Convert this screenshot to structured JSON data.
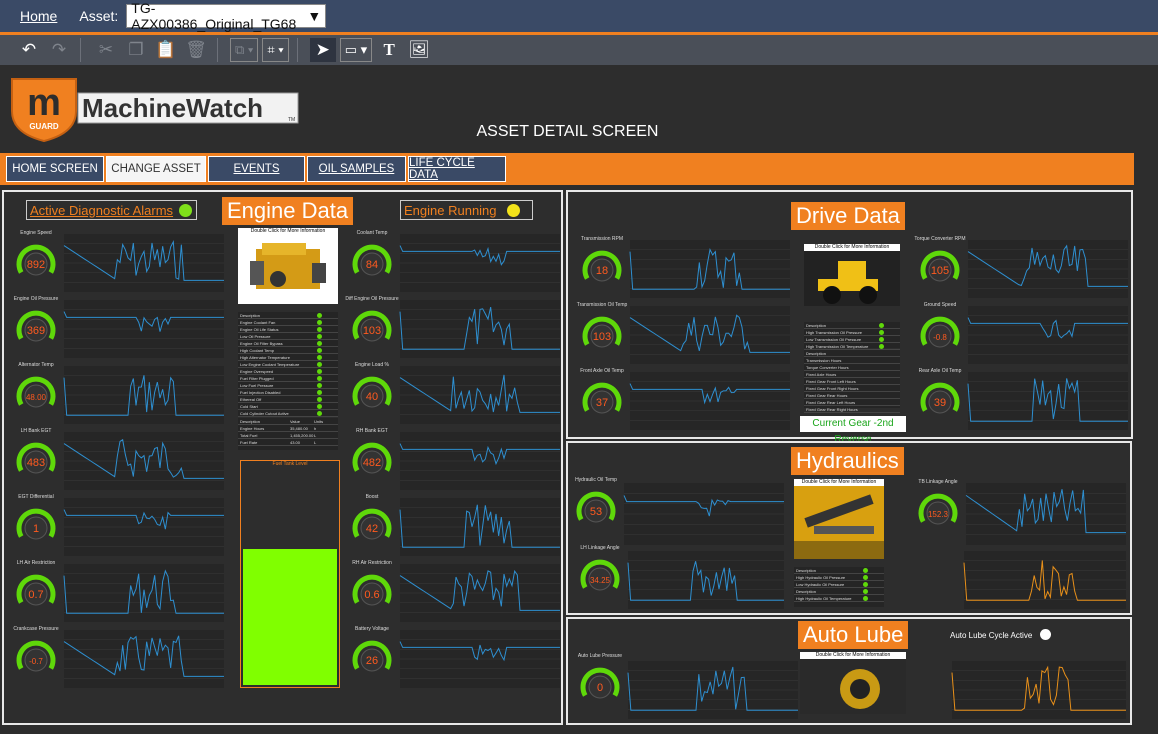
{
  "topbar": {
    "home_link": "Home",
    "asset_label": "Asset:",
    "asset_value": "TG-AZX00386_Original_TG68"
  },
  "toolbar": {
    "icons": [
      "undo-icon",
      "redo-icon",
      "cut-icon",
      "copy-icon",
      "paste-icon",
      "delete-icon",
      "group-icon",
      "grid-icon",
      "pointer-icon",
      "rectangle-icon",
      "text-icon",
      "image-icon"
    ]
  },
  "brand": {
    "logo_text": "MachineWatch",
    "shield_letter": "m",
    "shield_sub": "GUARD",
    "tm": "TM"
  },
  "page_title": "ASSET DETAIL SCREEN",
  "nav": [
    {
      "label": "HOME SCREEN"
    },
    {
      "label": "CHANGE ASSET"
    },
    {
      "label": "EVENTS"
    },
    {
      "label": "OIL SAMPLES"
    },
    {
      "label": "LIFE CYCLE DATA"
    }
  ],
  "engine": {
    "title": "Engine Data",
    "alarms_label": "Active Diagnostic Alarms",
    "running_label": "Engine Running",
    "thumb_caption": "Double Click for More Information",
    "fuel_label": "Fuel Tank Level",
    "fuel_level": 0.6,
    "left_gauges": [
      {
        "label": "Engine Speed",
        "value": "892"
      },
      {
        "label": "Engine Oil Pressure",
        "value": "369"
      },
      {
        "label": "Alternator Temp",
        "value": "48.00"
      },
      {
        "label": "LH Bank EGT",
        "value": "483"
      },
      {
        "label": "EGT Differential",
        "value": "1"
      },
      {
        "label": "LH Air Restriction",
        "value": "0.7"
      },
      {
        "label": "Crankcase Pressure",
        "value": "-0.7"
      }
    ],
    "right_gauges": [
      {
        "label": "Coolant Temp",
        "value": "84"
      },
      {
        "label": "Diff Engine Oil Pressure",
        "value": "103"
      },
      {
        "label": "Engine Load %",
        "value": "40"
      },
      {
        "label": "RH Bank EGT",
        "value": "482"
      },
      {
        "label": "Boost",
        "value": "42"
      },
      {
        "label": "RH Air Restriction",
        "value": "0.6"
      },
      {
        "label": "Battery Voltage",
        "value": "26"
      }
    ],
    "status_table": {
      "headers": [
        "Description",
        "Trend"
      ],
      "rows": [
        "Engine Coolant Fan",
        "Engine Oil Life Status",
        "Low Oil Pressure",
        "Engine Oil Filter Bypass",
        "High Coolant Temp",
        "High Alternator Temperature",
        "Low Engine Coolant Temperature",
        "Engine Overspeed",
        "Fuel Filter Plugged",
        "Low Fuel Pressure",
        "Fuel Injection Disabled",
        "Ethereal Off",
        "Cold Start",
        "Cold Cylinder Cutout Active"
      ]
    },
    "value_table": {
      "headers": [
        "Description",
        "Value",
        "Units"
      ],
      "rows": [
        [
          "Engine Hours",
          "35,480.00",
          "h"
        ],
        [
          "Total Fuel",
          "1,455,200.00",
          "L"
        ],
        [
          "Fuel Rate",
          "43.00",
          "L"
        ]
      ]
    }
  },
  "drive": {
    "title": "Drive Data",
    "thumb_caption": "Double Click for More Information",
    "gear_text": "Current Gear -2nd Reverse",
    "left_gauges": [
      {
        "label": "Transmission RPM",
        "value": "18"
      },
      {
        "label": "Transmission Oil Temp",
        "value": "103"
      },
      {
        "label": "Front Axle Oil Temp",
        "value": "37"
      }
    ],
    "right_gauges": [
      {
        "label": "Torque Converter RPM",
        "value": "105"
      },
      {
        "label": "Ground Speed",
        "value": "-0.8"
      },
      {
        "label": "Rear Axle Oil Temp",
        "value": "39"
      }
    ],
    "status_table": {
      "headers": [
        "Description",
        "Status",
        "Trend"
      ],
      "rows": [
        "High Transmission Oil Pressure",
        "Low Transmission Oil Pressure",
        "High Transmission Oil Temperature"
      ]
    },
    "value_table": {
      "headers": [
        "Description",
        "Value",
        "Units"
      ],
      "rows": [
        "Transmission Hours",
        "Torque Converter Hours",
        "Fixed Axle Hours",
        "Fixed Gear Front Left Hours",
        "Fixed Gear Front Right Hours",
        "Fixed Gear Rear Hours",
        "Fixed Gear Rear Left Hours",
        "Fixed Gear Rear Right Hours"
      ]
    }
  },
  "hydraulics": {
    "title": "Hydraulics",
    "thumb_caption": "Double Click for More Information",
    "gauges": [
      {
        "label": "Hydraulic Oil Temp",
        "value": "53"
      },
      {
        "label": "LH Linkage Angle",
        "value": "34.25"
      },
      {
        "label": "TB Linkage Angle",
        "value": "152.3"
      }
    ]
  },
  "autolube": {
    "title": "Auto Lube",
    "cycle_label": "Auto Lube Cycle Active",
    "thumb_caption": "Double Click for More Information",
    "gauge": {
      "label": "Auto Lube Pressure",
      "value": "0"
    }
  },
  "colors": {
    "accent": "#f08020",
    "topbar": "#3a4a66",
    "gauge_green": "#5fd80a",
    "value_orange": "#ff5a1f",
    "chart_line": "#2e8fd0",
    "alarm_green": "#7fe01a",
    "running_yellow": "#f2e21a"
  }
}
